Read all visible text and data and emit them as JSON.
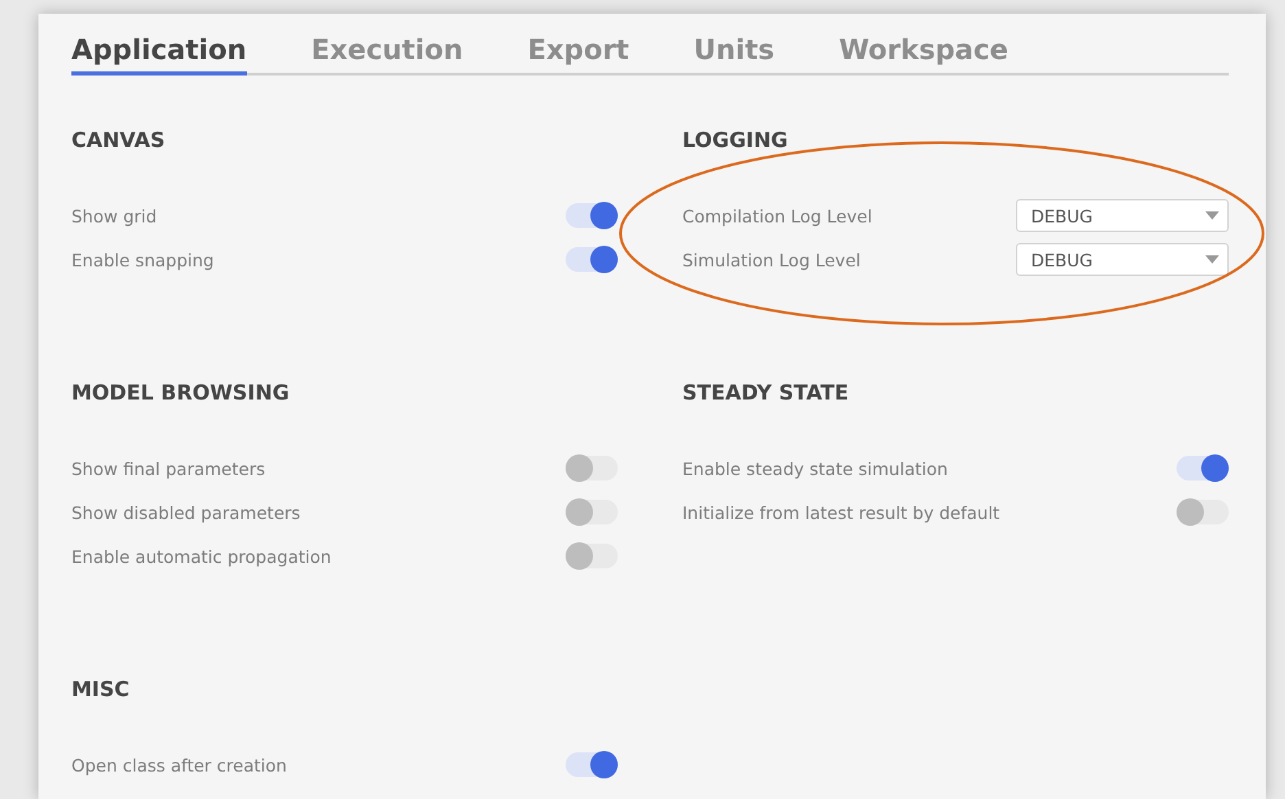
{
  "tabs": [
    {
      "label": "Application",
      "selected": true
    },
    {
      "label": "Execution",
      "selected": false
    },
    {
      "label": "Export",
      "selected": false
    },
    {
      "label": "Units",
      "selected": false
    },
    {
      "label": "Workspace",
      "selected": false
    }
  ],
  "sections": [
    {
      "title": "CANVAS",
      "rows": [
        {
          "kind": "toggle",
          "label": "Show grid",
          "on": true
        },
        {
          "kind": "toggle",
          "label": "Enable snapping",
          "on": true
        }
      ]
    },
    {
      "title": "LOGGING",
      "highlighted": true,
      "rows": [
        {
          "kind": "dropdown",
          "label": "Compilation Log Level",
          "value": "DEBUG"
        },
        {
          "kind": "dropdown",
          "label": "Simulation Log Level",
          "value": "DEBUG"
        }
      ]
    },
    {
      "title": "MODEL BROWSING",
      "rows": [
        {
          "kind": "toggle",
          "label": "Show final parameters",
          "on": false
        },
        {
          "kind": "toggle",
          "label": "Show disabled parameters",
          "on": false
        },
        {
          "kind": "toggle",
          "label": "Enable automatic propagation",
          "on": false
        }
      ]
    },
    {
      "title": "STEADY STATE",
      "rows": [
        {
          "kind": "toggle",
          "label": "Enable steady state simulation",
          "on": true
        },
        {
          "kind": "toggle",
          "label": "Initialize from latest result by default",
          "on": false
        }
      ]
    },
    {
      "title": "MISC",
      "rows": [
        {
          "kind": "toggle",
          "label": "Open class after creation",
          "on": true
        }
      ]
    }
  ]
}
